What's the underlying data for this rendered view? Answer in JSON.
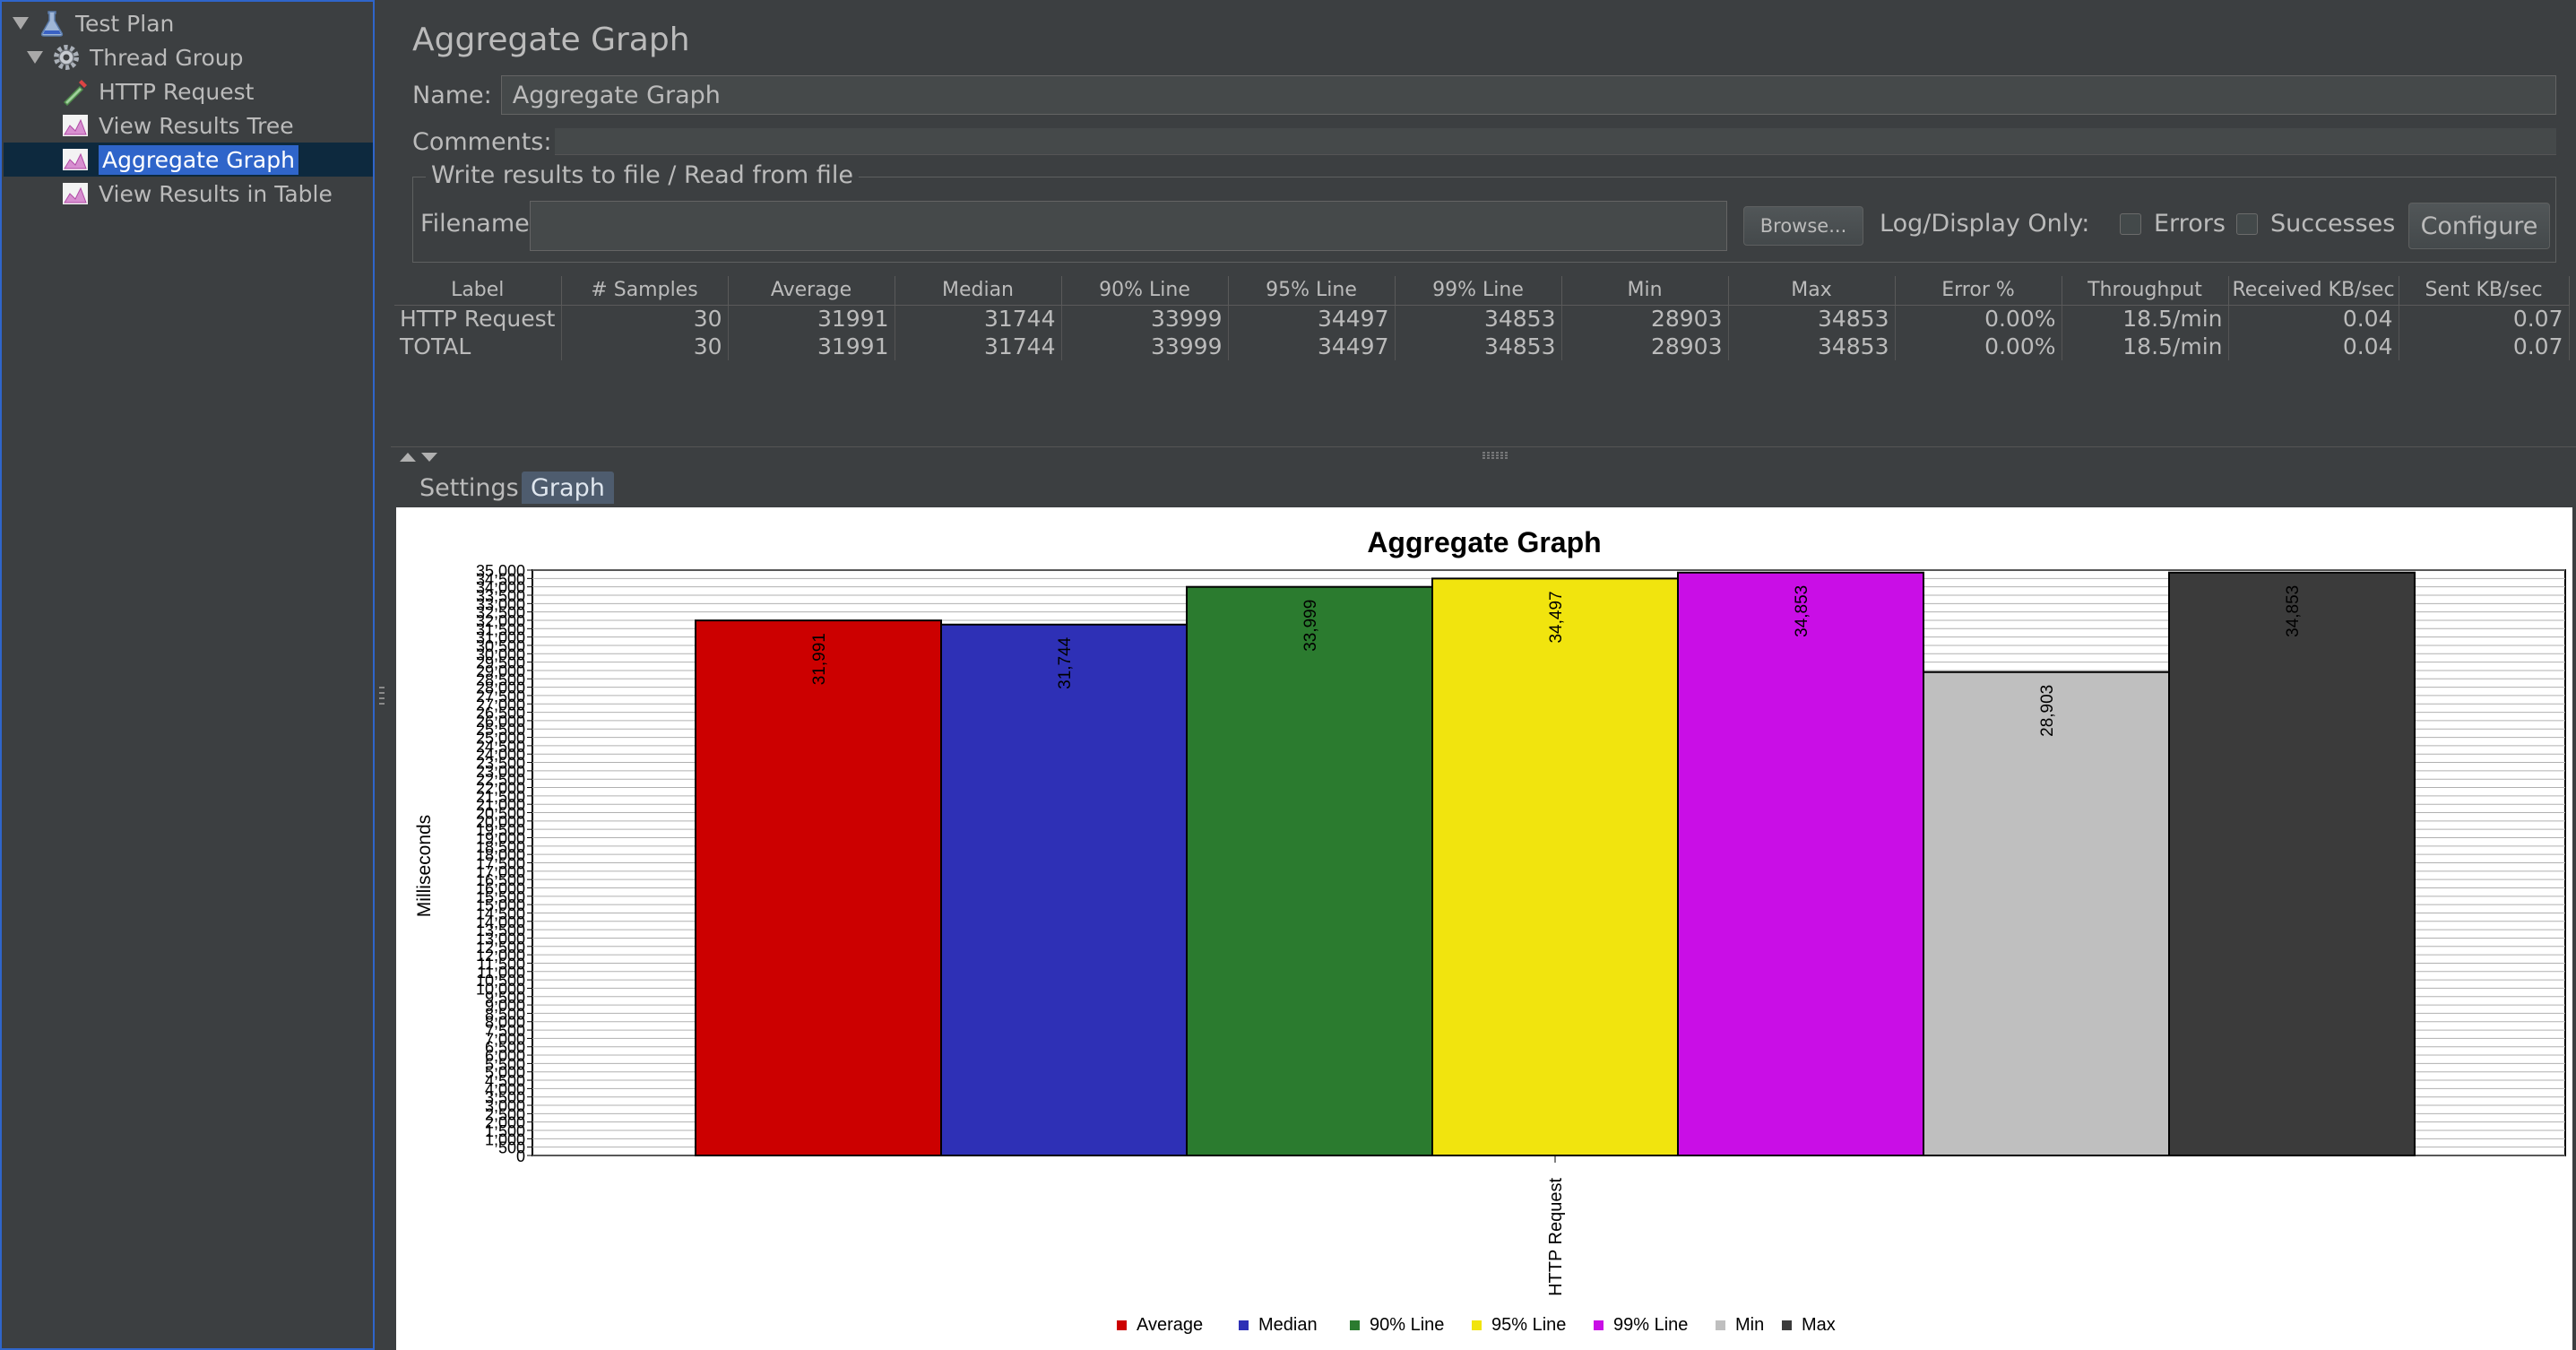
{
  "tree": {
    "items": [
      {
        "label": "Test Plan",
        "icon": "flask-icon"
      },
      {
        "label": "Thread Group",
        "icon": "gear-icon"
      },
      {
        "label": "HTTP Request",
        "icon": "pipette-icon"
      },
      {
        "label": "View Results Tree",
        "icon": "graph-icon"
      },
      {
        "label": "Aggregate Graph",
        "icon": "graph-icon",
        "selected": true
      },
      {
        "label": "View Results in Table",
        "icon": "graph-icon"
      }
    ]
  },
  "panel": {
    "title": "Aggregate Graph",
    "name_label": "Name:",
    "name_value": "Aggregate Graph",
    "comments_label": "Comments:",
    "comments_value": "",
    "fileset_legend": "Write results to file / Read from file",
    "filename_label": "Filename",
    "filename_value": "",
    "browse_label": "Browse...",
    "log_display_label": "Log/Display Only:",
    "errors_label": "Errors",
    "successes_label": "Successes",
    "configure_label": "Configure"
  },
  "table": {
    "columns": [
      "Label",
      "# Samples",
      "Average",
      "Median",
      "90% Line",
      "95% Line",
      "99% Line",
      "Min",
      "Max",
      "Error %",
      "Throughput",
      "Received KB/sec",
      "Sent KB/sec"
    ],
    "rows": [
      [
        "HTTP Request",
        "30",
        "31991",
        "31744",
        "33999",
        "34497",
        "34853",
        "28903",
        "34853",
        "0.00%",
        "18.5/min",
        "0.04",
        "0.07"
      ],
      [
        "TOTAL",
        "30",
        "31991",
        "31744",
        "33999",
        "34497",
        "34853",
        "28903",
        "34853",
        "0.00%",
        "18.5/min",
        "0.04",
        "0.07"
      ]
    ]
  },
  "tabs": {
    "settings": "Settings",
    "graph": "Graph"
  },
  "chart_data": {
    "type": "bar",
    "title": "Aggregate Graph",
    "ylabel": "Milliseconds",
    "xlabel": "",
    "categories": [
      "HTTP Request"
    ],
    "ylim": [
      0,
      35000
    ],
    "ytick_step": 500,
    "grid": true,
    "legend_position": "bottom",
    "series": [
      {
        "name": "Average",
        "values": [
          31991
        ],
        "label": "31,991",
        "color": "#cc0000"
      },
      {
        "name": "Median",
        "values": [
          31744
        ],
        "label": "31,744",
        "color": "#2e30b6"
      },
      {
        "name": "90% Line",
        "values": [
          33999
        ],
        "label": "33,999",
        "color": "#2b7b2f"
      },
      {
        "name": "95% Line",
        "values": [
          34497
        ],
        "label": "34,497",
        "color": "#f1e40e"
      },
      {
        "name": "99% Line",
        "values": [
          34853
        ],
        "label": "34,853",
        "color": "#c90ee6"
      },
      {
        "name": "Min",
        "values": [
          28903
        ],
        "label": "28,903",
        "color": "#bfbfbf"
      },
      {
        "name": "Max",
        "values": [
          34853
        ],
        "label": "34,853",
        "color": "#3b3b3b"
      }
    ]
  }
}
